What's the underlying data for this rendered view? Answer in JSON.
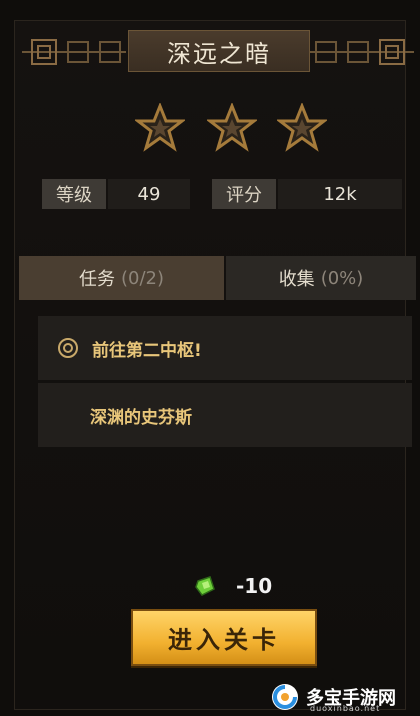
{
  "title": "深远之暗",
  "stars": {
    "earned": 0,
    "total": 3
  },
  "stats": {
    "level_label": "等级",
    "level_value": "49",
    "score_label": "评分",
    "score_value": "12k"
  },
  "tabs": [
    {
      "label": "任务",
      "count": "(0/2)"
    },
    {
      "label": "收集",
      "count": "(0%)"
    }
  ],
  "tasks": [
    {
      "text": "前往第二中枢!"
    },
    {
      "text": "深渊的史芬斯"
    }
  ],
  "cost": {
    "icon": "gem-icon",
    "value": "-10"
  },
  "enter_button": "进入关卡",
  "watermark": {
    "text": "多宝手游网",
    "sub": "duoxinbao.net"
  },
  "colors": {
    "accent_gold": "#e8c67a",
    "button_gold": "#f2b130",
    "background": "#0f0d0b"
  }
}
